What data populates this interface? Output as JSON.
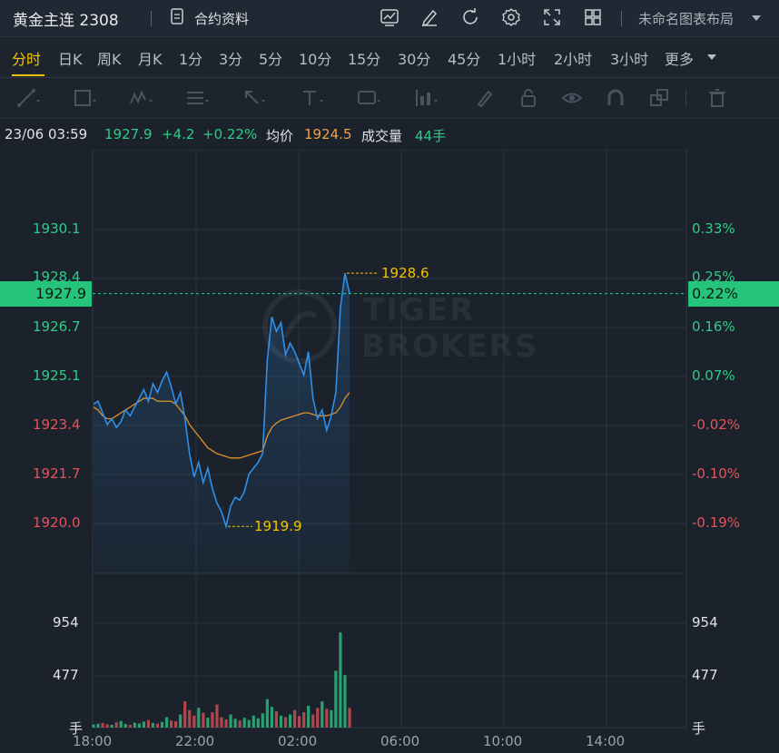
{
  "toolbar": {
    "symbol": "黄金主连 2308",
    "doc_label": "合约资料",
    "layout_label": "未命名图表布局",
    "icons": [
      "indicator-icon",
      "draw-icon",
      "refresh-icon",
      "settings-icon",
      "fullscreen-icon",
      "grid-layout-icon"
    ]
  },
  "periods": {
    "items": [
      "分时",
      "日K",
      "周K",
      "月K",
      "1分",
      "3分",
      "5分",
      "10分",
      "15分",
      "30分",
      "45分",
      "1小时",
      "2小时",
      "3小时",
      "更多"
    ],
    "active": "分时"
  },
  "draw_tools": [
    "line-tool-icon",
    "rect-tool-icon",
    "wave-tool-icon",
    "fib-tool-icon",
    "arrow-tool-icon",
    "text-tool-icon",
    "label-tool-icon",
    "measure-tool-icon",
    "brush-icon",
    "lock-icon",
    "eye-icon",
    "magnet-icon",
    "clone-icon",
    "trash-icon"
  ],
  "info": {
    "time": "23/06 03:59",
    "price": "1927.9",
    "change": "+4.2",
    "pct": "+0.22%",
    "avg_label": "均价",
    "avg": "1924.5",
    "vol_label": "成交量",
    "vol": "44手"
  },
  "colors": {
    "up": "#2ecc87",
    "down": "#e5535a",
    "price_line": "#2f8fe8",
    "avg_line": "#e0902c",
    "highlight": "#f5c300"
  },
  "chart_data": {
    "type": "line",
    "price_axis_left": [
      "1930.1",
      "1928.4",
      "1926.7",
      "1925.1",
      "1923.4",
      "1921.7",
      "1920.0"
    ],
    "price_axis_right": [
      "0.33%",
      "0.25%",
      "0.16%",
      "0.07%",
      "-0.02%",
      "-0.10%",
      "-0.19%"
    ],
    "current_price": "1927.9",
    "current_pct": "0.22%",
    "high_label": "1928.6",
    "low_label": "1919.9",
    "volume_axis": [
      "954",
      "477",
      "手"
    ],
    "x_labels": [
      "18:00",
      "22:00",
      "02:00",
      "06:00",
      "10:00",
      "14:00"
    ],
    "ylim": [
      1918.2,
      1932.0
    ],
    "prev_close": 1923.7,
    "series": [
      {
        "values": [
          1924.1,
          1924.2,
          1923.8,
          1923.4,
          1923.6,
          1923.3,
          1923.5,
          1923.9,
          1923.7,
          1924.0,
          1924.3,
          1924.6,
          1924.2,
          1924.8,
          1924.5,
          1924.9,
          1925.2,
          1924.7,
          1924.1,
          1924.5,
          1923.6,
          1922.4,
          1921.6,
          1922.1,
          1921.4,
          1921.9,
          1921.2,
          1920.7,
          1920.4,
          1919.9,
          1920.6,
          1920.9,
          1920.8,
          1921.1,
          1921.7,
          1921.9,
          1922.1,
          1922.4,
          1925.6,
          1927.1,
          1926.6,
          1926.9,
          1925.8,
          1926.2,
          1925.9,
          1925.5,
          1925.1,
          1925.9,
          1924.3,
          1923.6,
          1923.9,
          1923.2,
          1923.7,
          1924.5,
          1927.4,
          1928.6,
          1927.9
        ]
      },
      {
        "values": [
          1924.0,
          1923.9,
          1923.7,
          1923.6,
          1923.6,
          1923.7,
          1923.8,
          1923.9,
          1924.0,
          1924.1,
          1924.2,
          1924.3,
          1924.3,
          1924.3,
          1924.2,
          1924.2,
          1924.2,
          1924.2,
          1924.1,
          1923.9,
          1923.7,
          1923.4,
          1923.2,
          1923.0,
          1922.8,
          1922.6,
          1922.5,
          1922.4,
          1922.35,
          1922.3,
          1922.25,
          1922.25,
          1922.25,
          1922.3,
          1922.35,
          1922.4,
          1922.45,
          1922.5,
          1923.0,
          1923.3,
          1923.45,
          1923.55,
          1923.6,
          1923.65,
          1923.7,
          1923.75,
          1923.8,
          1923.8,
          1923.75,
          1923.7,
          1923.7,
          1923.7,
          1923.75,
          1923.8,
          1924.0,
          1924.3,
          1924.5
        ]
      }
    ],
    "volume": [
      28,
      35,
      42,
      31,
      26,
      48,
      60,
      33,
      25,
      45,
      38,
      55,
      70,
      43,
      36,
      52,
      95,
      64,
      58,
      120,
      240,
      160,
      110,
      180,
      135,
      90,
      140,
      210,
      95,
      75,
      120,
      80,
      65,
      90,
      70,
      110,
      85,
      130,
      260,
      190,
      150,
      110,
      95,
      120,
      160,
      105,
      140,
      200,
      120,
      180,
      240,
      170,
      160,
      520,
      870,
      480,
      180
    ]
  }
}
